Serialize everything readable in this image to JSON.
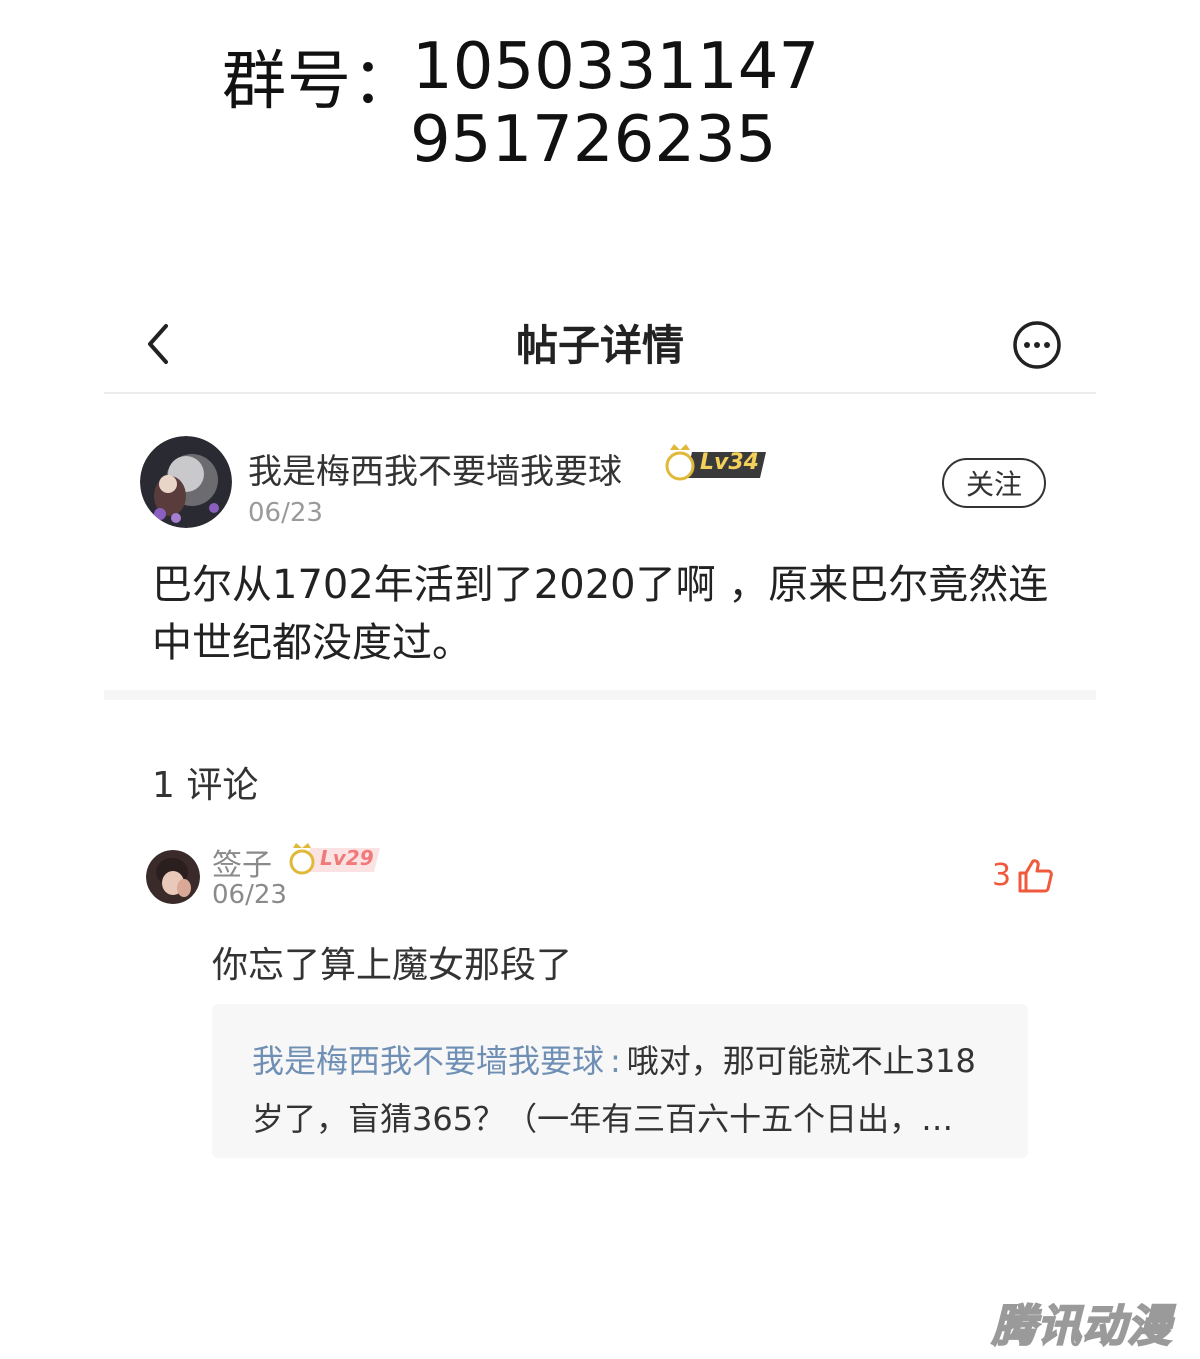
{
  "group": {
    "label": "群号：",
    "number1": "1050331147",
    "number2": "951726235"
  },
  "header": {
    "title": "帖子详情",
    "back_icon": "chevron-left-icon",
    "more_icon": "more-options-icon"
  },
  "post": {
    "author": "我是梅西我不要墙我要球",
    "level": "Lv34",
    "date": "06/23",
    "follow_label": "关注",
    "body": "巴尔从1702年活到了2020了啊 ，原来巴尔竟然连中世纪都没度过。"
  },
  "comments_section": {
    "count_label": "1 评论"
  },
  "comment": {
    "author": "签子",
    "level": "Lv29",
    "date": "06/23",
    "likes": "3",
    "body": "你忘了算上魔女那段了",
    "reply": {
      "author": "我是梅西我不要墙我要球",
      "separator": ":",
      "line1": "哦对，那可能就不止318",
      "line2": "岁了，盲猜365？（一年有三百六十五个日出，…"
    }
  },
  "watermark": "腾讯动漫",
  "colors": {
    "like_accent": "#f05a3c",
    "reply_name": "#6f8fb5",
    "badge_main": "#3a3a3a",
    "badge_gold": "#e0b93a"
  }
}
